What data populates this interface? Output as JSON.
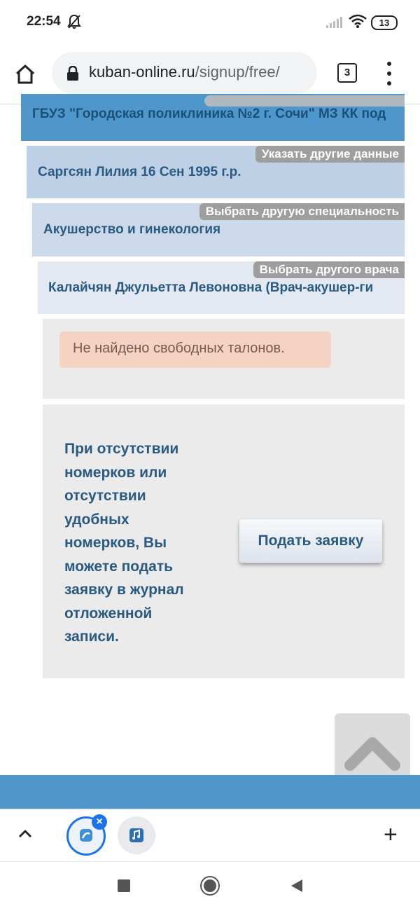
{
  "status_bar": {
    "time": "22:54",
    "battery": "13"
  },
  "browser": {
    "url_domain": "kuban-online.ru",
    "url_path": "/signup/free/",
    "tab_count": "3",
    "new_tab_label": "+",
    "close_tab_label": "×"
  },
  "breadcrumb": {
    "clinic": "ГБУЗ \"Городская поликлиника №2 г. Сочи\" МЗ КК под",
    "patient": {
      "text": "Саргсян Лилия 16 Сен 1995 г.р.",
      "action": "Указать другие данные"
    },
    "specialty": {
      "text": "Акушерство и гинекология",
      "action": "Выбрать другую специальность"
    },
    "doctor": {
      "text": "Калайчян Джульетта Левоновна (Врач-акушер-ги",
      "action": "Выбрать другого врача"
    }
  },
  "tickets": {
    "alert": "Не найдено свободных талонов."
  },
  "request": {
    "info": "При отсутствии номерков или отсутствии удобных номерков, Вы можете подать заявку в журнал отложенной записи.",
    "button_label": "Подать заявку"
  },
  "icons": {
    "bell": "bell-off-icon",
    "signal": "signal-icon",
    "wifi": "wifi-icon",
    "lock": "lock-icon",
    "home": "home-icon",
    "menu": "more-vert-icon",
    "scroll_top": "chevron-up-icon"
  },
  "colors": {
    "link_blue": "#2a5a82",
    "header_blue": "#4f97cb",
    "alert_bg": "#f4d3c3",
    "accent": "#1a73e8"
  }
}
